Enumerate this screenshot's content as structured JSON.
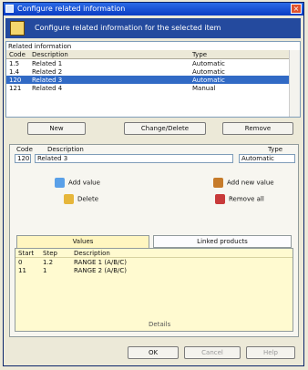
{
  "window": {
    "title": "Configure related information",
    "close_glyph": "×"
  },
  "header": {
    "text": "Configure related information for the selected item"
  },
  "grid": {
    "title": "Related information",
    "columns": [
      "Code",
      "Description",
      "Type"
    ],
    "rows": [
      {
        "code": "1.5",
        "description": "Related 1",
        "type": "Automatic"
      },
      {
        "code": "1.4",
        "description": "Related 2",
        "type": "Automatic"
      },
      {
        "code": "120",
        "description": "Related 3",
        "type": "Automatic",
        "selected": true
      },
      {
        "code": "121",
        "description": "Related 4",
        "type": "Manual"
      }
    ]
  },
  "actions": {
    "new": "New",
    "change": "Change/Delete",
    "remove": "Remove"
  },
  "detail": {
    "code_label": "Code",
    "code_value": "120",
    "desc_label": "Description",
    "desc_value": "Related 3",
    "type_label": "Type",
    "type_value": "Automatic"
  },
  "tools": {
    "t1": "Add value",
    "t2": "Add new value",
    "t3": "Delete",
    "t4": "Remove all"
  },
  "tabs": {
    "t1": "Values",
    "t2": "Linked products"
  },
  "values": {
    "columns": [
      "Start",
      "Step",
      "Description"
    ],
    "rows": [
      {
        "start": "0",
        "step": "1.2",
        "description": "RANGE 1 (A/B/C)"
      },
      {
        "start": "11",
        "step": "1",
        "description": "RANGE 2 (A/B/C)"
      }
    ],
    "link_label": "Details"
  },
  "footer": {
    "ok": "OK",
    "cancel": "Cancel",
    "help": "Help"
  }
}
